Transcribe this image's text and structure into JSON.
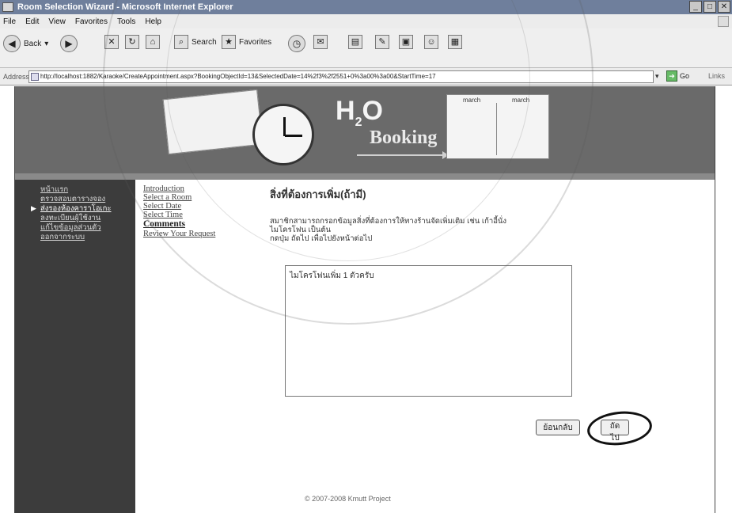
{
  "window": {
    "title": "Room Selection Wizard - Microsoft Internet Explorer",
    "buttons": [
      "_",
      "□",
      "✕"
    ]
  },
  "menu": [
    "File",
    "Edit",
    "View",
    "Favorites",
    "Tools",
    "Help"
  ],
  "toolbar": {
    "back_label": "Back",
    "search_label": "Search",
    "favorites_label": "Favorites"
  },
  "address": {
    "label": "Address",
    "url": "http://localhost:1882/Karaoke/CreateAppointment.aspx?BookingObjectId=13&SelectedDate=14%2f3%2f2551+0%3a00%3a00&StartTime=17",
    "go_label": "Go",
    "links_label": "Links"
  },
  "banner": {
    "logo_main": "H",
    "logo_sub": "2",
    "logo_o": "O",
    "logo_booking": "Booking",
    "chart_col1": "march",
    "chart_col2": "march"
  },
  "leftnav": {
    "items": [
      "หน้าแรก",
      "ตรวจสอบตารางจอง",
      "ส่งรองห้องคาราโอเกะ",
      "ลงทะเบียนผู้ใช้งาน",
      "แก้ไขข้อมูลส่วนตัว",
      "ออกจากระบบ"
    ],
    "current_index": 2
  },
  "wizard": {
    "steps": [
      "Introduction",
      "Select a Room",
      "Select Date",
      "Select Time",
      "Comments",
      "Review Your Request"
    ],
    "active_index": 4
  },
  "content": {
    "heading": "สิ่งที่ต้องการเพิ่ม(ถ้ามี)",
    "instructions": [
      "สมาชิกสามารถกรอกข้อมูลสิ่งที่ต้องการให้ทางร้านจัดเพิ่มเติม เช่น เก้าอี้นั่ง",
      "ไมโครโฟน เป็นต้น",
      "กดปุ่ม ถัดไป เพื่อไปยังหน้าต่อไป"
    ],
    "comment_value": "ไมโครโฟนเพิ่ม 1 ตัวครับ"
  },
  "buttons": {
    "back": "ย้อนกลับ",
    "next": "ถัดไป"
  },
  "footer": "© 2007-2008 Kmutt Project"
}
